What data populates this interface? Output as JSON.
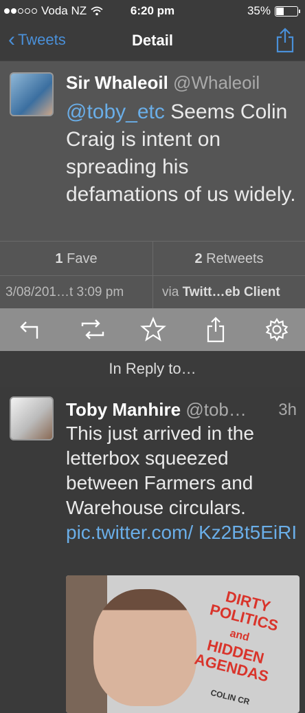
{
  "status": {
    "carrier": "Voda NZ",
    "time": "6:20 pm",
    "battery": "35%",
    "battery_level": 0.35
  },
  "nav": {
    "back_label": "Tweets",
    "title": "Detail"
  },
  "tweet": {
    "name": "Sir Whaleoil",
    "handle": "@Whaleoil",
    "mention": "@toby_etc",
    "text": "Seems Colin Craig is intent on spreading his defamations of us widely.",
    "fave_count": "1",
    "fave_label": "Fave",
    "retweet_count": "2",
    "retweet_label": "Retweets",
    "date": "3/08/201…t 3:09 pm",
    "via": "via",
    "client": "Twitt…eb Client"
  },
  "actions": {
    "icons": [
      "reply-icon",
      "retweet-icon",
      "favorite-icon",
      "share-icon",
      "settings-icon"
    ]
  },
  "reply_header": "In Reply to…",
  "reply": {
    "name": "Toby Manhire",
    "handle": "@tob…",
    "time": "3h",
    "text": "This just arrived in the letterbox squeezed between Farmers and Warehouse circulars.",
    "link": "pic.twitter.com/ Kz2Bt5EiRI",
    "photo": {
      "headline": "DIRTY POLITICS",
      "and": "and",
      "headline2": "HIDDEN AGENDAS",
      "author": "COLIN CR"
    }
  },
  "colors": {
    "accent": "#4a90d9",
    "link": "#6aaee8",
    "actionbar": "#8e8e8e"
  }
}
